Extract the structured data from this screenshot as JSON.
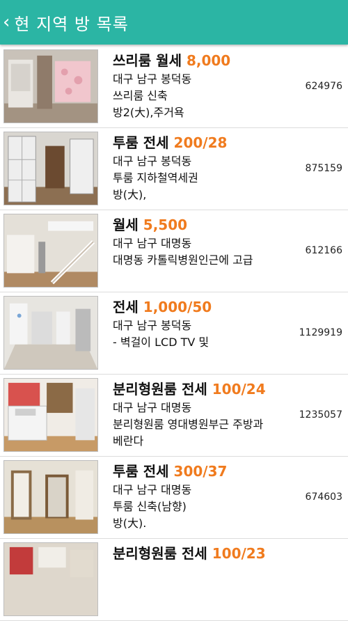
{
  "header": {
    "back_icon": "‹",
    "title": "현 지역 방 목록"
  },
  "listings": [
    {
      "type": "쓰리룸 월세",
      "price": "8,000",
      "area": "대구 남구 봉덕동",
      "desc1": "쓰리룸 신축",
      "desc2": " 방2(大),주거욕",
      "code": "624976"
    },
    {
      "type": "투룸 전세",
      "price": "200/28",
      "area": "대구 남구 봉덕동",
      "desc1": "투룸 지하철역세권",
      "desc2": " 방(大),",
      "code": "875159"
    },
    {
      "type": " 월세",
      "price": "5,500",
      "area": "대구 남구 대명동",
      "desc1": " 대명동 카톨릭병원인근에 고급",
      "desc2": "",
      "code": "612166"
    },
    {
      "type": " 전세",
      "price": "1,000/50",
      "area": "대구 남구 봉덕동",
      "desc1": " - 벽걸이 LCD TV 및",
      "desc2": "",
      "code": "1129919"
    },
    {
      "type": "분리형원룸 전세",
      "price": "100/24",
      "area": "대구 남구 대명동",
      "desc1": "분리형원룸 영대병원부근 주방과",
      "desc2": "베란다",
      "code": "1235057"
    },
    {
      "type": "투룸 전세",
      "price": "300/37",
      "area": "대구 남구 대명동",
      "desc1": "투룸 신축(남향)",
      "desc2": " 방(大).",
      "code": "674603"
    },
    {
      "type": "분리형원룸 전세",
      "price": "100/23",
      "area": "",
      "desc1": "",
      "desc2": "",
      "code": ""
    }
  ]
}
